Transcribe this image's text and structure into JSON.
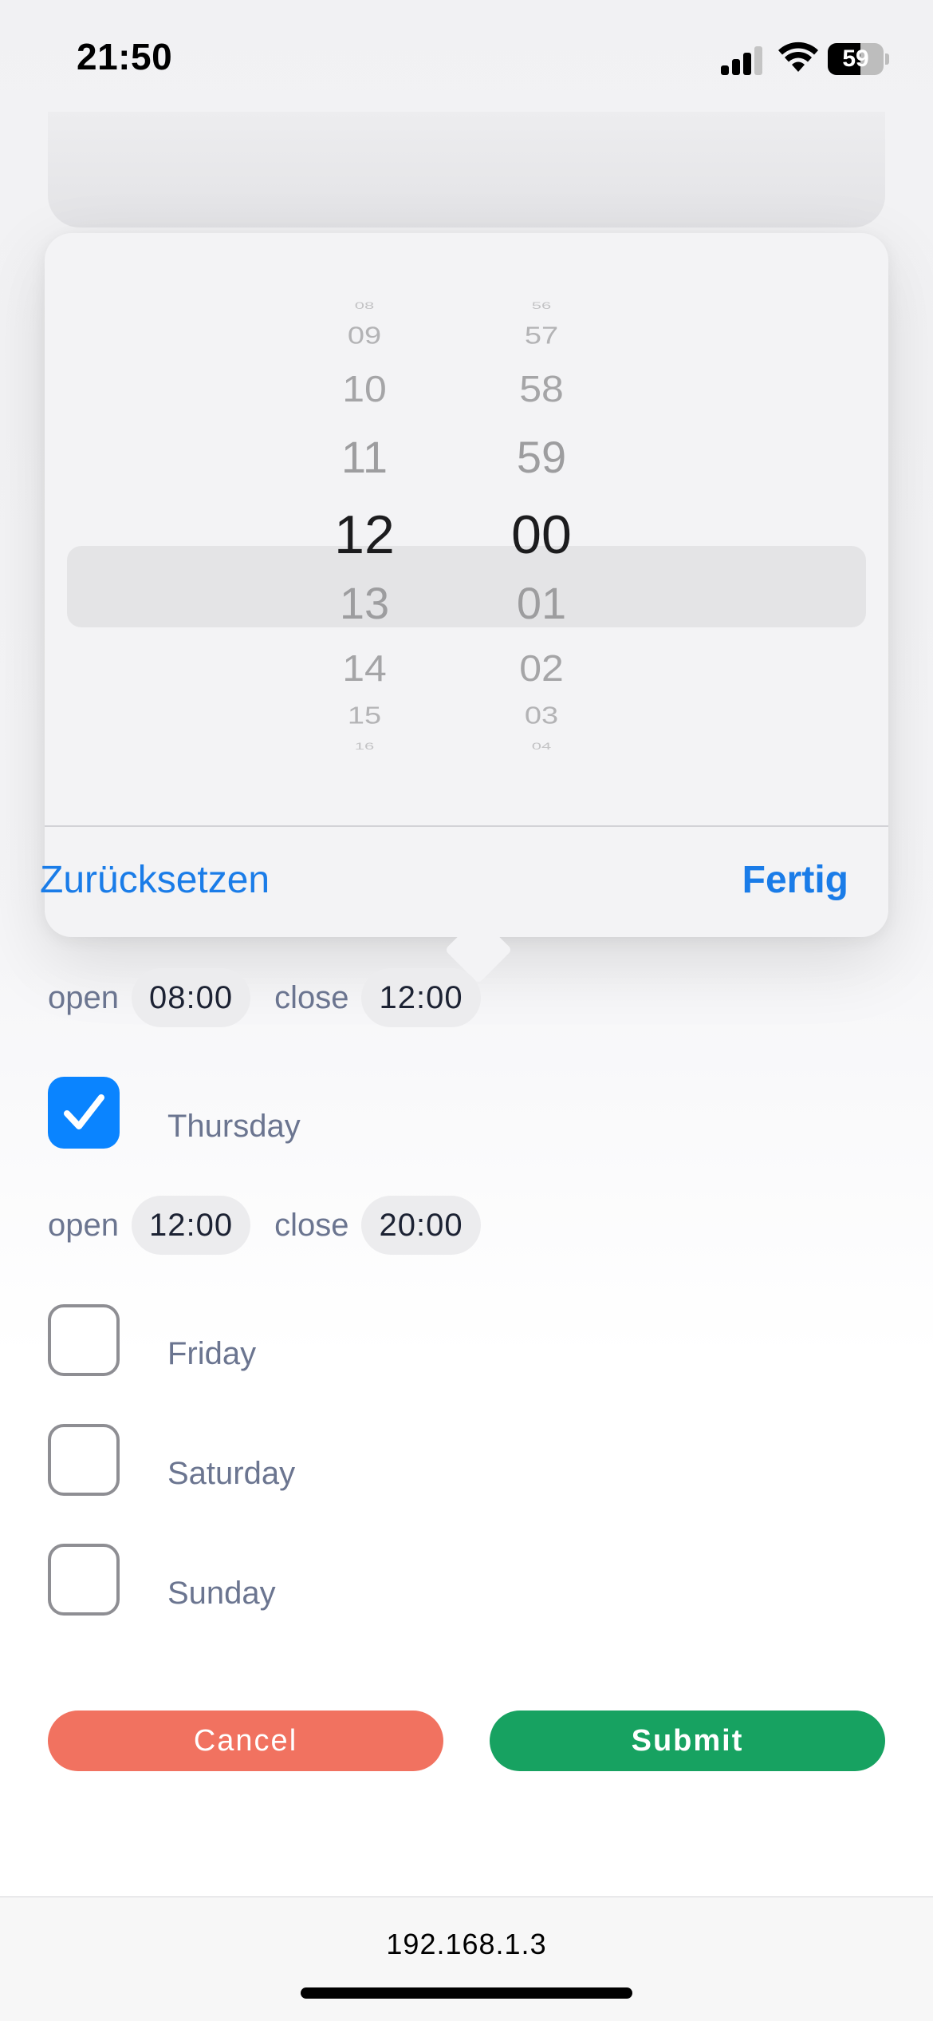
{
  "status_bar": {
    "time": "21:50",
    "battery_level": "59",
    "battery_fraction": 0.59,
    "signal_bars_active": 3,
    "signal_bars_total": 4
  },
  "time_picker": {
    "hour_column": [
      "08",
      "09",
      "10",
      "11",
      "12",
      "13",
      "14",
      "15",
      "16"
    ],
    "minute_column": [
      "56",
      "57",
      "58",
      "59",
      "00",
      "01",
      "02",
      "03",
      "04"
    ],
    "selected_hour": "12",
    "selected_minute": "00",
    "reset_label": "Zurücksetzen",
    "done_label": "Fertig",
    "accent_color": "#1a7ce8"
  },
  "schedule": {
    "wednesday_hours": {
      "open_label": "open",
      "open_time": "08:00",
      "close_label": "close",
      "close_time": "12:00"
    },
    "days": [
      {
        "label": "Thursday",
        "checked": true,
        "hours": {
          "open_label": "open",
          "open_time": "12:00",
          "close_label": "close",
          "close_time": "20:00"
        }
      },
      {
        "label": "Friday",
        "checked": false
      },
      {
        "label": "Saturday",
        "checked": false
      },
      {
        "label": "Sunday",
        "checked": false
      }
    ]
  },
  "actions": {
    "cancel_label": "Cancel",
    "submit_label": "Submit",
    "cancel_color": "#f17260",
    "submit_color": "#17a261"
  },
  "browser": {
    "url": "192.168.1.3"
  }
}
